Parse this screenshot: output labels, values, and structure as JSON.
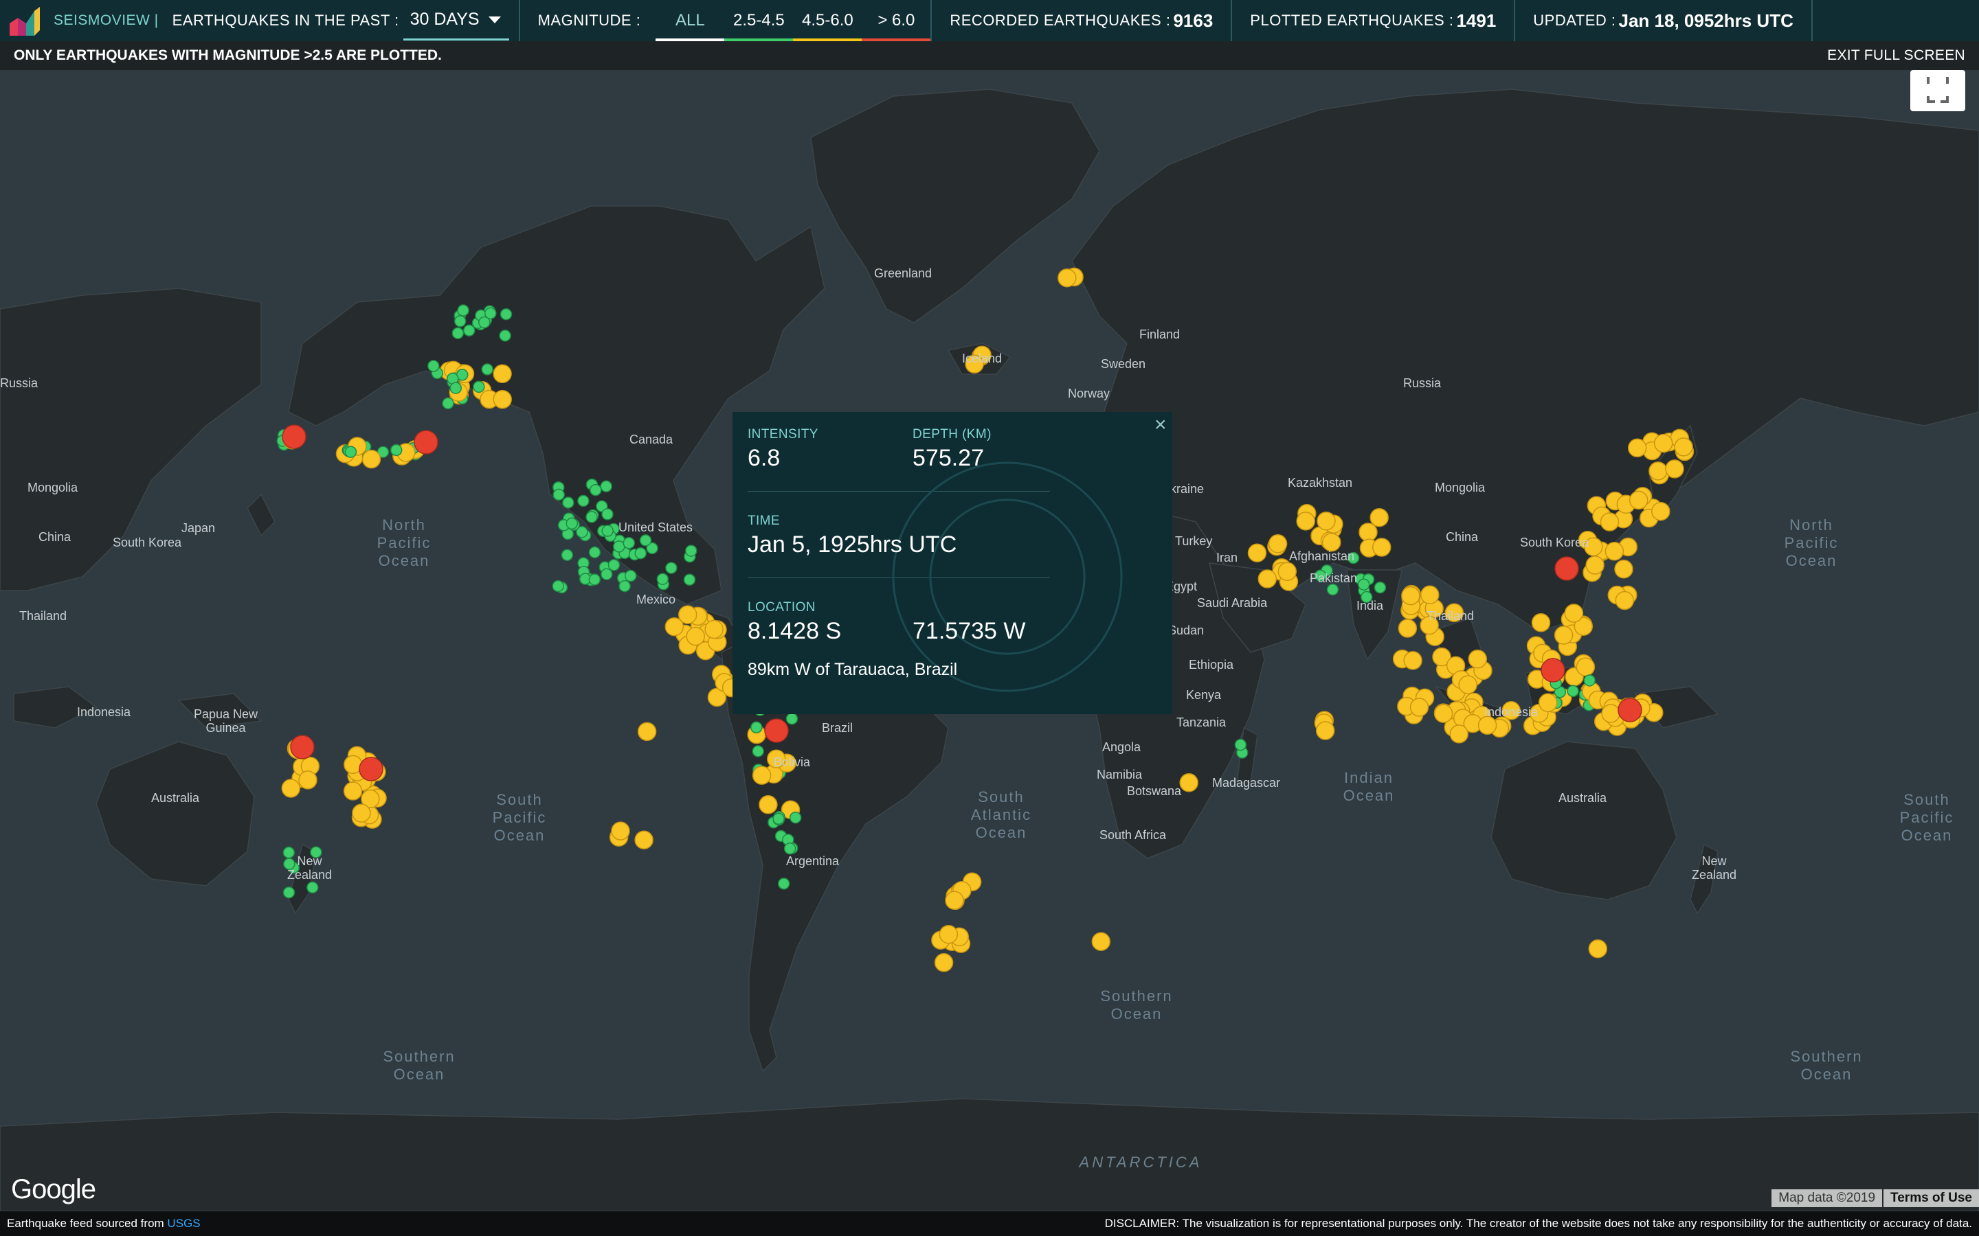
{
  "header": {
    "brand": "SEISMOVIEW |",
    "period_label": "EARTHQUAKES IN THE PAST :",
    "period_value": "30 DAYS",
    "magnitude_label": "MAGNITUDE :",
    "magnitude_options": [
      {
        "label": "ALL",
        "color": "#ffffff"
      },
      {
        "label": "2.5-4.5",
        "color": "#3ecf6a"
      },
      {
        "label": "4.5-6.0",
        "color": "#f5c518"
      },
      {
        "label": "> 6.0",
        "color": "#e84a3a"
      }
    ],
    "recorded_label": "RECORDED EARTHQUAKES :",
    "recorded_value": "9163",
    "plotted_label": "PLOTTED EARTHQUAKES :",
    "plotted_value": "1491",
    "updated_label": "UPDATED :",
    "updated_value": "Jan 18, 0952hrs UTC"
  },
  "notice": {
    "text": "ONLY EARTHQUAKES WITH MAGNITUDE >2.5 ARE PLOTTED.",
    "exit_fullscreen": "EXIT FULL SCREEN"
  },
  "map": {
    "labels": {
      "greenland": "Greenland",
      "finland": "Finland",
      "sweden": "Sweden",
      "norway": "Norway",
      "iceland": "Iceland",
      "russia_east": "Russia",
      "russia_west": "Russia",
      "canada": "Canada",
      "united_states": "United States",
      "mexico": "Mexico",
      "brazil": "Brazil",
      "bolivia": "Bolivia",
      "argentina": "Argentina",
      "mongolia_west": "Mongolia",
      "mongolia_east": "Mongolia",
      "china_west": "China",
      "china_east": "China",
      "japan": "Japan",
      "south_korea_west": "South Korea",
      "south_korea_east": "South Korea",
      "thailand_west": "Thailand",
      "thailand_east": "Thailand",
      "indonesia_west": "Indonesia",
      "indonesia_east": "Indonesia",
      "papua_new_guinea": "Papua New\nGuinea",
      "australia_west": "Australia",
      "australia_east": "Australia",
      "new_zealand_west": "New\nZealand",
      "new_zealand_east": "New\nZealand",
      "kazakhstan": "Kazakhstan",
      "afghanistan": "Afghanistan",
      "pakistan": "Pakistan",
      "india": "India",
      "saudi_arabia": "Saudi Arabia",
      "iran": "Iran",
      "turkey": "Turkey",
      "ukraine": "Ukraine",
      "egypt": "Egypt",
      "sudan": "Sudan",
      "ethiopia": "Ethiopia",
      "kenya": "Kenya",
      "tanzania": "Tanzania",
      "angola": "Angola",
      "namibia": "Namibia",
      "botswana": "Botswana",
      "south_africa": "South Africa",
      "madagascar": "Madagascar"
    },
    "oceans": {
      "north_pacific_west": "North\nPacific\nOcean",
      "north_pacific_east": "North\nPacific\nOcean",
      "south_pacific_west": "South\nPacific\nOcean",
      "south_pacific_east": "South\nPacific\nOcean",
      "south_atlantic": "South\nAtlantic\nOcean",
      "indian": "Indian\nOcean",
      "southern_1": "Southern\nOcean",
      "southern_2": "Southern\nOcean",
      "southern_3": "Southern\nOcean",
      "antarctica": "ANTARCTICA"
    },
    "google_logo": "Google",
    "map_data": "Map data ©2019",
    "terms": "Terms of Use",
    "fullscreen_icon": "fullscreen-icon"
  },
  "popup": {
    "intensity_label": "INTENSITY",
    "intensity_value": "6.8",
    "depth_label": "DEPTH (KM)",
    "depth_value": "575.27",
    "time_label": "TIME",
    "time_value": "Jan 5, 1925hrs UTC",
    "location_label": "LOCATION",
    "latitude": "8.1428 S",
    "longitude": "71.5735 W",
    "place": "89km W of Tarauaca, Brazil",
    "close_icon": "close-icon"
  },
  "footer": {
    "source_text": "Earthquake feed sourced from",
    "source_link": "USGS",
    "disclaimer": "DISCLAIMER: The visualization is for representational purposes only. The creator of the website does not take any responsibility for the authenticity or accuracy of data."
  },
  "colors": {
    "green": "#3ecf6a",
    "yellow": "#f9c524",
    "red": "#e8402f",
    "accent": "#7fd3cf",
    "header_bg": "#102d33"
  }
}
